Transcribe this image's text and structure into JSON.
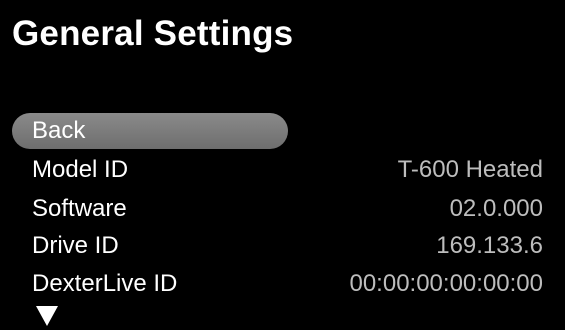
{
  "header": {
    "title": "General Settings"
  },
  "menu": {
    "back_label": "Back",
    "rows": [
      {
        "label": "Model ID",
        "value": "T-600 Heated"
      },
      {
        "label": "Software",
        "value": "02.0.000"
      },
      {
        "label": "Drive ID",
        "value": "169.133.6"
      },
      {
        "label": "DexterLive ID",
        "value": "00:00:00:00:00:00"
      }
    ],
    "scroll_indicator_icon": "down-triangle-icon"
  },
  "colors": {
    "background": "#000000",
    "text": "#ffffff",
    "value_text": "#bdbdbd",
    "highlight": "#7a7a7a"
  }
}
